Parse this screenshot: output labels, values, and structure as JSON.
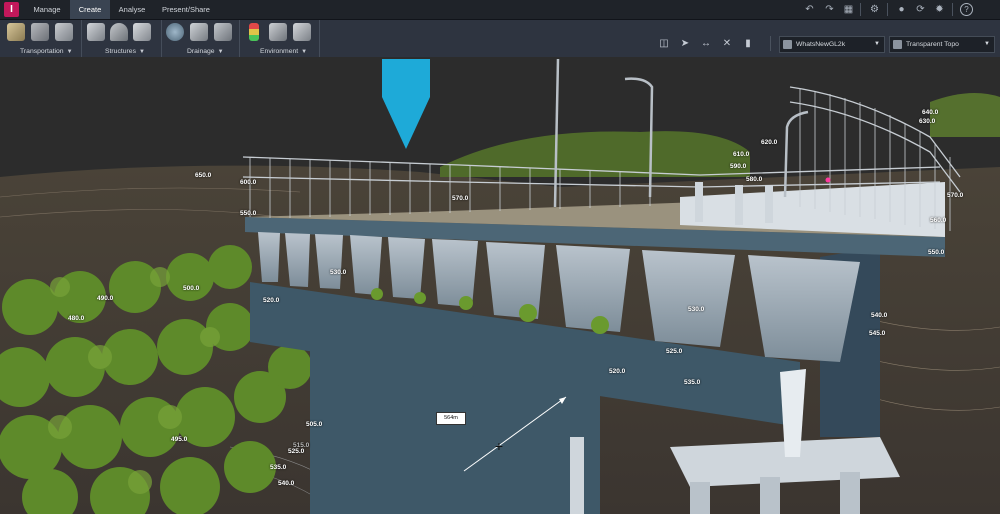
{
  "app": {
    "logo": "I"
  },
  "tabs": [
    {
      "label": "Manage",
      "active": false
    },
    {
      "label": "Create",
      "active": true
    },
    {
      "label": "Analyse",
      "active": false
    },
    {
      "label": "Present/Share",
      "active": false
    }
  ],
  "ribbon": {
    "groups": [
      {
        "label": "Transportation",
        "icons": [
          "road-icon",
          "railway-icon",
          "bridge-pier-icon"
        ]
      },
      {
        "label": "Structures",
        "icons": [
          "bridge-deck-icon",
          "tunnel-icon",
          "building-icon"
        ]
      },
      {
        "label": "Drainage",
        "icons": [
          "pipe-network-icon",
          "culvert-icon",
          "pipe-icon"
        ]
      },
      {
        "label": "Environment",
        "icons": [
          "traffic-light-icon",
          "tree-icon",
          "city-furniture-icon"
        ]
      }
    ],
    "style_dropdown": {
      "value": "WhatsNewGL2k"
    },
    "terrain_dropdown": {
      "value": "Transparent Topo"
    }
  },
  "viewport": {
    "elevation_labels": [
      "650.0",
      "600.0",
      "550.0",
      "570.0",
      "610.0",
      "590.0",
      "580.0",
      "620.0",
      "640.0",
      "630.0",
      "570.0",
      "560.0",
      "550.0",
      "530.0",
      "520.0",
      "490.0",
      "500.0",
      "480.0",
      "530.0",
      "525.0",
      "520.0",
      "535.0",
      "540.0",
      "545.0",
      "495.0",
      "505.0",
      "515.0",
      "525.0",
      "535.0",
      "540.0"
    ],
    "measurement": {
      "value": "564m"
    },
    "colors": {
      "sky": "#2b2b2b",
      "bridge": "#3e5868",
      "rail": "#c7cdd3",
      "marker": "#1eaad8",
      "vegetation": "#5e8a2a"
    }
  }
}
